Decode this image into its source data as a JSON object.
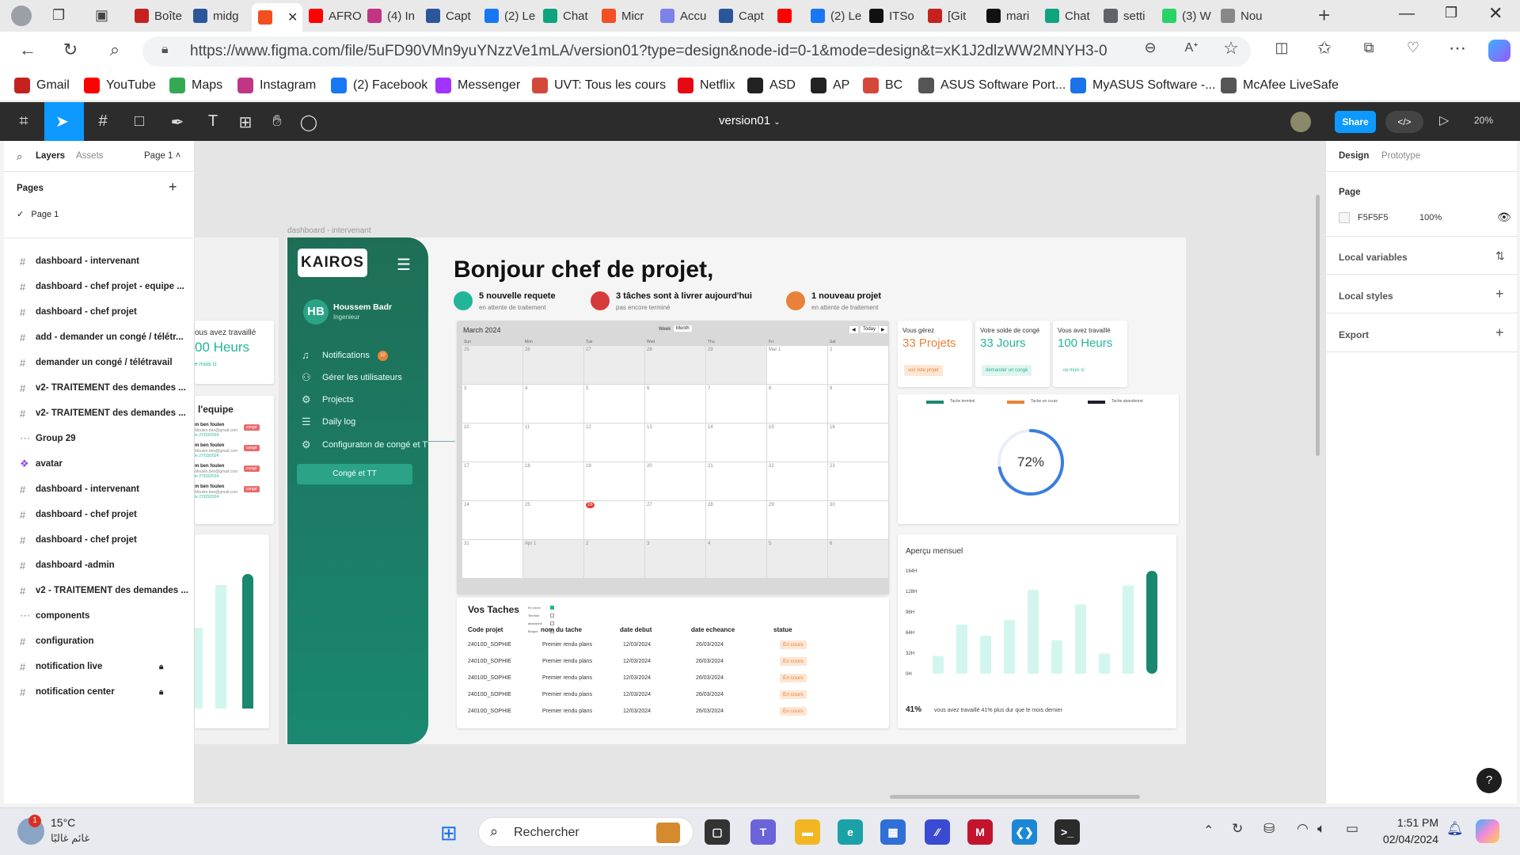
{
  "browser": {
    "tabs": [
      {
        "title": "Boîte",
        "color": "#c5221f",
        "icon": "gmail-icon"
      },
      {
        "title": "midg",
        "color": "#2b579a",
        "icon": "docs-icon"
      },
      {
        "title": "",
        "color": "#f24e1e",
        "icon": "figma-icon",
        "active": true
      },
      {
        "title": "AFRO",
        "color": "#ff0000",
        "icon": "youtube-icon"
      },
      {
        "title": "(4) In",
        "color": "#c13584",
        "icon": "instagram-icon"
      },
      {
        "title": "Capt",
        "color": "#2b579a",
        "icon": "word-icon"
      },
      {
        "title": "(2) Le",
        "color": "#1877f2",
        "icon": "facebook-icon"
      },
      {
        "title": "Chat",
        "color": "#10a37f",
        "icon": "chatgpt-icon"
      },
      {
        "title": "Micr",
        "color": "#f25022",
        "icon": "microsoft-icon"
      },
      {
        "title": "Accu",
        "color": "#7b83eb",
        "icon": "copilot-icon"
      },
      {
        "title": "Capt",
        "color": "#2b579a",
        "icon": "word-icon"
      },
      {
        "title": "",
        "color": "#ff0000",
        "icon": "youtube-icon"
      },
      {
        "title": "(2) Le",
        "color": "#1877f2",
        "icon": "facebook-icon"
      },
      {
        "title": "ITSo",
        "color": "#111111",
        "icon": "github-icon"
      },
      {
        "title": "[Git",
        "color": "#c5221f",
        "icon": "gmail-icon"
      },
      {
        "title": "mari",
        "color": "#111111",
        "icon": "github-icon"
      },
      {
        "title": "Chat",
        "color": "#10a37f",
        "icon": "chatgpt-icon"
      },
      {
        "title": "setti",
        "color": "#5f6368",
        "icon": "search-icon"
      },
      {
        "title": "(3) W",
        "color": "#25d366",
        "icon": "whatsapp-icon"
      },
      {
        "title": "Nou",
        "color": "#888888",
        "icon": "page-icon"
      }
    ],
    "url": "https://www.figma.com/file/5uFD90VMn9yuYNzzVe1mLA/version01?type=design&node-id=0-1&mode=design&t=xK1J2dlzWW2MNYH3-0",
    "bookmarks": [
      {
        "label": "Gmail",
        "color": "#c5221f"
      },
      {
        "label": "YouTube",
        "color": "#ff0000"
      },
      {
        "label": "Maps",
        "color": "#34a853"
      },
      {
        "label": "Instagram",
        "color": "#c13584"
      },
      {
        "label": "(2) Facebook",
        "color": "#1877f2"
      },
      {
        "label": "Messenger",
        "color": "#a033ff"
      },
      {
        "label": "UVT: Tous les cours",
        "color": "#d4483b"
      },
      {
        "label": "Netflix",
        "color": "#e50914"
      },
      {
        "label": "ASD",
        "color": "#222222"
      },
      {
        "label": "AP",
        "color": "#222222"
      },
      {
        "label": "BC",
        "color": "#d4483b"
      },
      {
        "label": "ASUS Software Port...",
        "color": "#555555"
      },
      {
        "label": "MyASUS Software -...",
        "color": "#1a73e8"
      },
      {
        "label": "McAfee LiveSafe",
        "color": "#555555"
      }
    ]
  },
  "figma": {
    "file_name": "version01",
    "share": "Share",
    "zoom": "20%",
    "left": {
      "tabs": [
        "Layers",
        "Assets"
      ],
      "page_selector": "Page 1",
      "pages_title": "Pages",
      "current_page": "Page 1",
      "layers": [
        {
          "name": "dashboard - intervenant",
          "type": "frame"
        },
        {
          "name": "dashboard - chef projet - equipe ...",
          "type": "frame"
        },
        {
          "name": "dashboard - chef projet",
          "type": "frame"
        },
        {
          "name": "add - demander un congé / télétr...",
          "type": "frame"
        },
        {
          "name": "demander un congé / télétravail",
          "type": "frame"
        },
        {
          "name": "v2- TRAITEMENT des demandes ...",
          "type": "frame"
        },
        {
          "name": "v2- TRAITEMENT des demandes ...",
          "type": "frame"
        },
        {
          "name": "Group 29",
          "type": "group"
        },
        {
          "name": "avatar",
          "type": "component"
        },
        {
          "name": "dashboard - intervenant",
          "type": "frame"
        },
        {
          "name": "dashboard - chef projet",
          "type": "frame"
        },
        {
          "name": "dashboard - chef projet",
          "type": "frame"
        },
        {
          "name": "dashboard -admin",
          "type": "frame"
        },
        {
          "name": "v2 - TRAITEMENT des demandes ...",
          "type": "frame"
        },
        {
          "name": "components",
          "type": "group"
        },
        {
          "name": "configuration",
          "type": "frame"
        },
        {
          "name": "notification live",
          "type": "frame",
          "locked": true
        },
        {
          "name": "notification center",
          "type": "frame",
          "locked": true
        }
      ]
    },
    "right": {
      "tabs": [
        "Design",
        "Prototype"
      ],
      "page_label": "Page",
      "page_color": "F5F5F5",
      "page_opacity": "100%",
      "sections": [
        "Local variables",
        "Local styles",
        "Export"
      ]
    }
  },
  "design": {
    "frame_label": "dashboard - intervenant",
    "logo": "KAIROS",
    "user": {
      "initials": "HB",
      "name": "Houssem Badr",
      "role": "Ingenieur"
    },
    "menu": [
      {
        "label": "Notifications",
        "icon": "bell-icon",
        "badge": "10"
      },
      {
        "label": "Gérer les utilisateurs",
        "icon": "users-icon"
      },
      {
        "label": "Projects",
        "icon": "projects-icon"
      },
      {
        "label": "Daily log",
        "icon": "log-icon"
      },
      {
        "label": "Configuraton de congé et TT",
        "icon": "gear-icon"
      },
      {
        "label": "Congé et TT",
        "icon": "",
        "active": true
      }
    ],
    "greeting": "Bonjour chef de projet,",
    "alerts": [
      {
        "title": "5 nouvelle requete",
        "sub": "en attente de traitement",
        "color": "#23b59a"
      },
      {
        "title": "3 tâches sont à livrer aujourd'hui",
        "sub": "pas encore terminé",
        "color": "#d63b3b"
      },
      {
        "title": "1 nouveau projet",
        "sub": "en attente de traitement",
        "color": "#e8823a"
      }
    ],
    "calendar": {
      "month": "March 2024",
      "views": [
        "Week",
        "Month"
      ],
      "today": "Today",
      "weekdays": [
        "Sun",
        "Mon",
        "Tue",
        "Wed",
        "Thu",
        "Fri",
        "Sat"
      ],
      "weeks": [
        [
          "25",
          "26",
          "27",
          "28",
          "29",
          "Mar 1",
          "2"
        ],
        [
          "3",
          "4",
          "5",
          "6",
          "7",
          "8",
          "9"
        ],
        [
          "10",
          "11",
          "12",
          "13",
          "14",
          "15",
          "16"
        ],
        [
          "17",
          "18",
          "19",
          "20",
          "21",
          "22",
          "23"
        ],
        [
          "24",
          "25",
          "26",
          "27",
          "28",
          "29",
          "30"
        ],
        [
          "31",
          "Apr 1",
          "2",
          "3",
          "4",
          "5",
          "6"
        ]
      ],
      "highlight": "26"
    },
    "stats": [
      {
        "label": "Vous gérez",
        "value": "33 Projets",
        "action": "voir liste projet",
        "color": "#e8823a",
        "bg": "#fde6d3"
      },
      {
        "label": "Votre solde de congé",
        "value": "33 Jours",
        "action": "demander un congé",
        "color": "#23b59a",
        "bg": "#dff5ef"
      },
      {
        "label": "Vous avez travaillé",
        "value": "100 Heurs",
        "action": "ce mois ci",
        "color": "#23b59a",
        "bg": "#ffffff"
      }
    ],
    "progress": {
      "legend": [
        {
          "label": "Tache terminé",
          "color": "#1a8870"
        },
        {
          "label": "Tache en cours",
          "color": "#e8823a"
        },
        {
          "label": "Tache abandonné",
          "color": "#1e1e2e"
        }
      ],
      "percent": "72%",
      "fraction": 0.72
    },
    "tasks": {
      "title": "Vos Taches",
      "filters": [
        "En cours",
        "Terminé",
        "abandoné",
        "Bloqué"
      ],
      "columns": [
        "Code projet",
        "nom du tache",
        "date debut",
        "date  echeance",
        "statue"
      ],
      "rows": [
        [
          "24010D_SOPHIE",
          "Premier rendu plans",
          "12/03/2024",
          "26/03/2024",
          "En cours"
        ],
        [
          "24010D_SOPHIE",
          "Premier rendu plans",
          "12/03/2024",
          "26/03/2024",
          "En cours"
        ],
        [
          "24010D_SOPHIE",
          "Premier rendu plans",
          "12/03/2024",
          "26/03/2024",
          "En cours"
        ],
        [
          "24010D_SOPHIE",
          "Premier rendu plans",
          "12/03/2024",
          "26/03/2024",
          "En cours"
        ],
        [
          "24010D_SOPHIE",
          "Premier rendu plans",
          "12/03/2024",
          "26/03/2024",
          "En cours"
        ]
      ]
    },
    "chart_data": {
      "type": "bar",
      "title": "Aperçu mensuel",
      "yticks": [
        "164H",
        "128H",
        "96H",
        "64H",
        "32H",
        "0H"
      ],
      "ylim": [
        0,
        164
      ],
      "values": [
        32,
        88,
        68,
        96,
        150,
        60,
        124,
        36,
        158,
        184
      ],
      "highlight_last": true,
      "footer_value": "41%",
      "footer_text": "vous avez travaillé 41% plus dur que le mois dernier"
    },
    "behind": {
      "work_label": "ous avez travaillé",
      "work_value": "00 Heurs",
      "work_sub": "e mois ci",
      "team_title": "l'equipe",
      "members": [
        {
          "name": "m ben foulen",
          "mail": "bfoulen.ben@gmail.com",
          "date": "le 27/03/2024",
          "tag": "congé"
        },
        {
          "name": "m ben foulen",
          "mail": "bfoulen.ben@gmail.com",
          "date": "le 27/03/2024",
          "tag": "congé"
        },
        {
          "name": "m ben foulen",
          "mail": "bfoulen.ben@gmail.com",
          "date": "le 27/03/2024",
          "tag": "congé"
        },
        {
          "name": "m ben foulen",
          "mail": "bfoulen.ben@gmail.com",
          "date": "le 27/03/2024",
          "tag": "congé"
        }
      ]
    }
  },
  "taskbar": {
    "weather_temp": "15°C",
    "weather_desc": "غائم غالبًا",
    "search": "Rechercher",
    "time": "1:51 PM",
    "date": "02/04/2024",
    "weather_badge": "1"
  }
}
